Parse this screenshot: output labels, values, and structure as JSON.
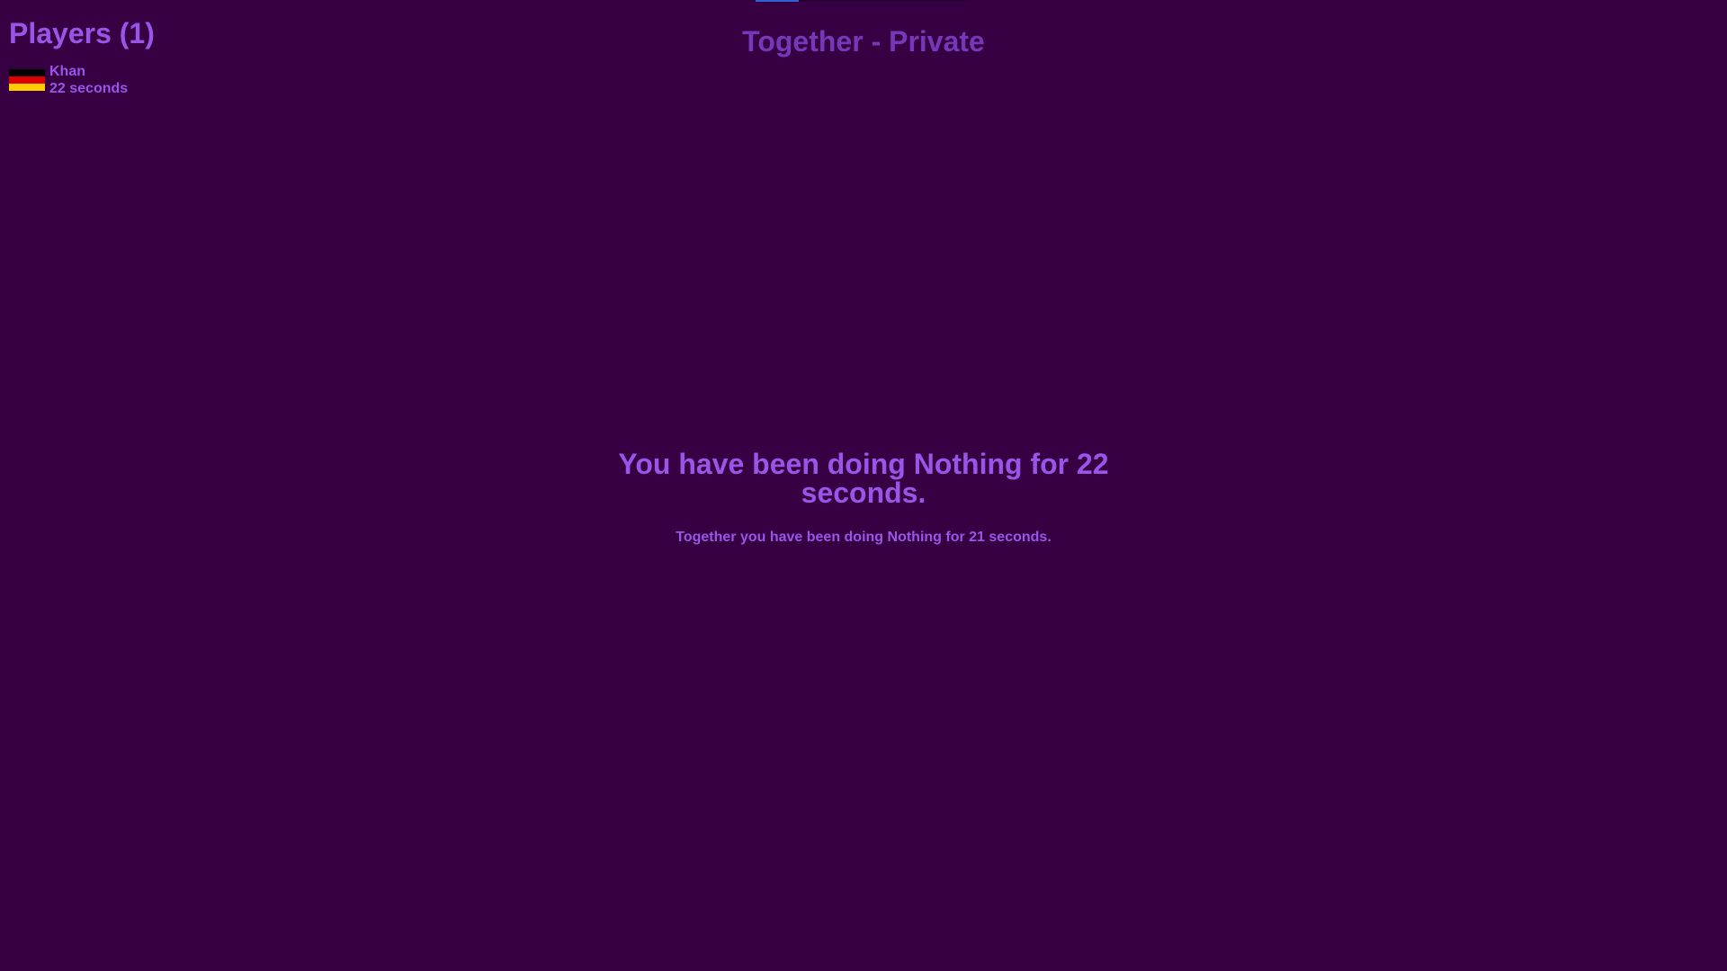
{
  "header": {
    "room_title": "Together - Private",
    "progress_fraction": 0.2
  },
  "players": {
    "heading": "Players (1)",
    "list": [
      {
        "name": "Khan",
        "time": "22 seconds",
        "flag": "germany-flag-icon"
      }
    ]
  },
  "status": {
    "main_message": "You have been doing Nothing for 22 seconds.",
    "sub_message": "Together you have been doing Nothing for 21 seconds."
  },
  "colors": {
    "background": "#360042",
    "text": "#9a55e8",
    "title": "#7438b8",
    "progress": "#2f5fd0"
  }
}
